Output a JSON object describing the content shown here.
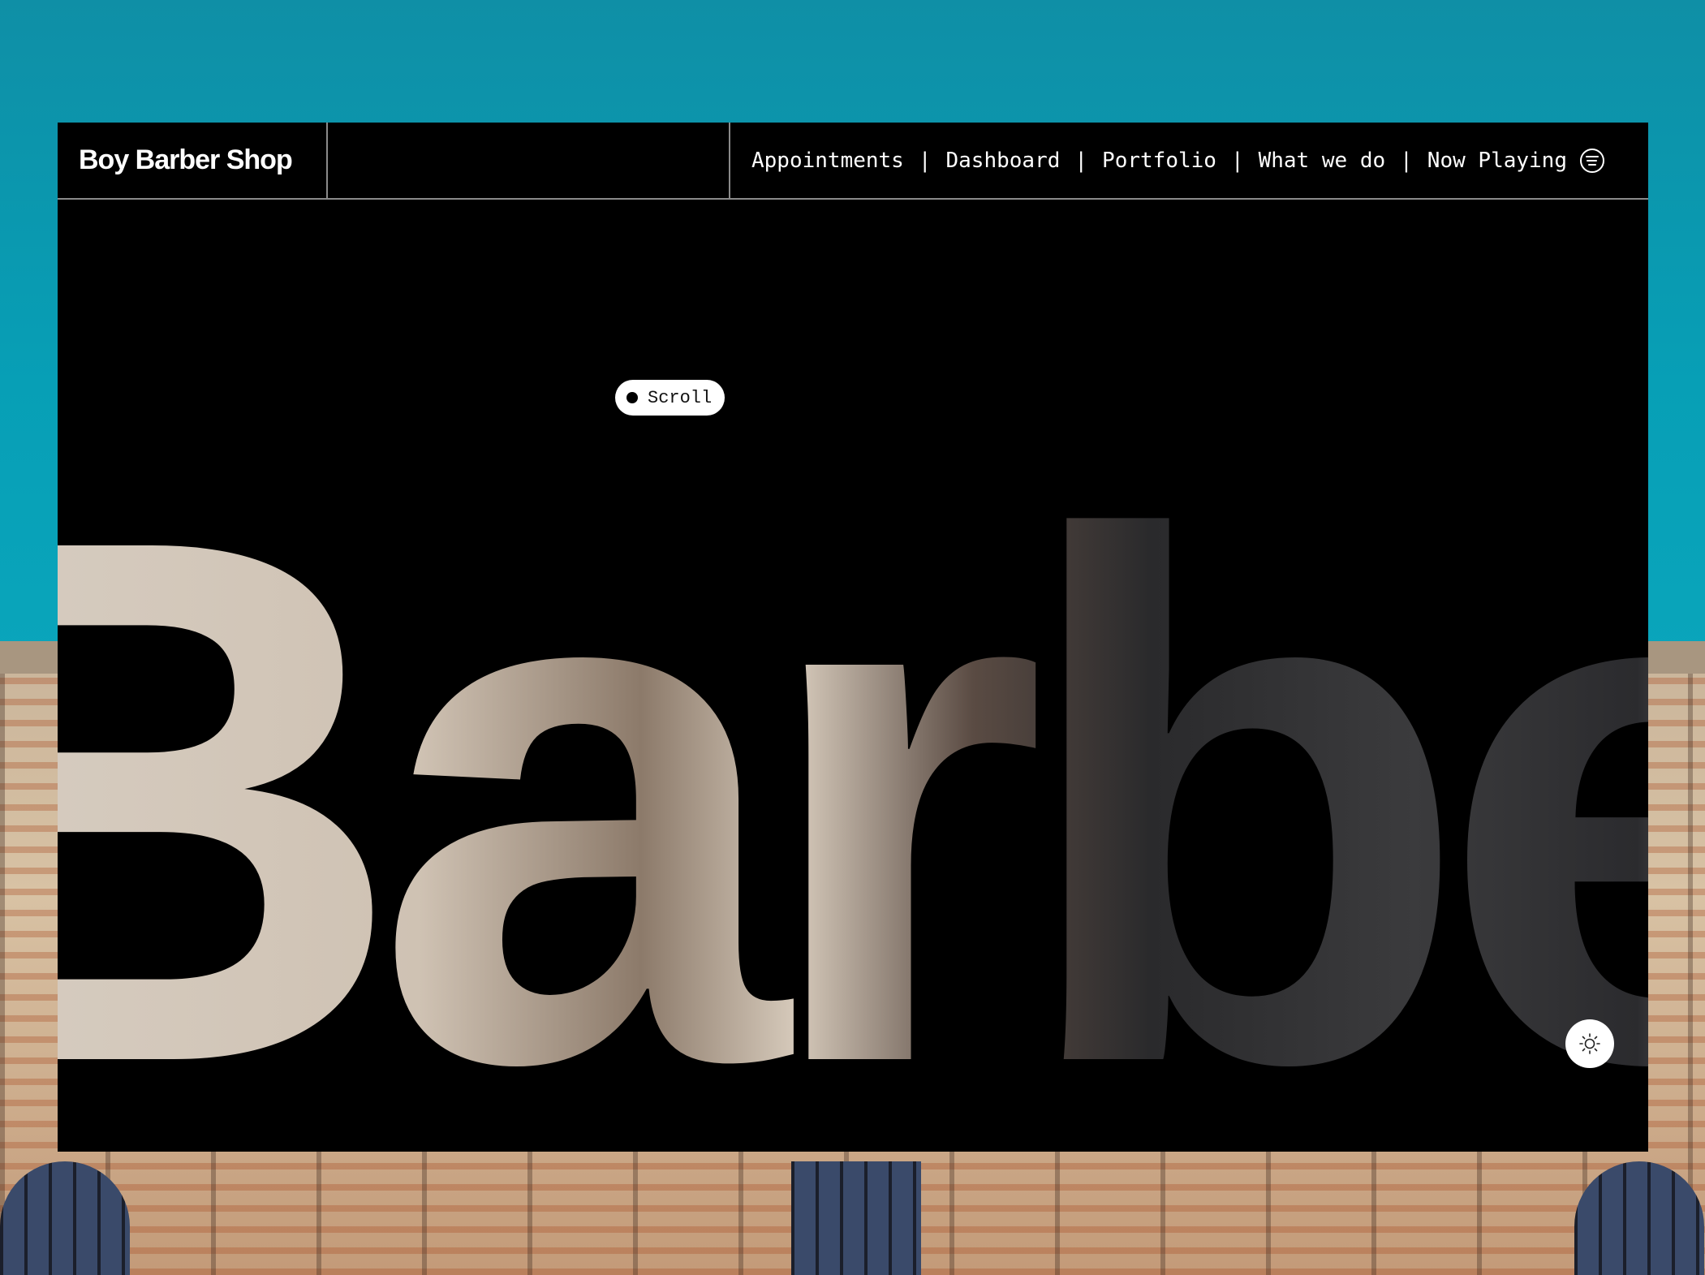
{
  "header": {
    "brand": "Boy Barber Shop",
    "nav": [
      {
        "label": "Appointments"
      },
      {
        "label": "Dashboard"
      },
      {
        "label": "Portfolio"
      },
      {
        "label": "What we do"
      },
      {
        "label": "Now Playing"
      }
    ],
    "separator": "|",
    "now_playing_icon": "spotify-icon"
  },
  "hero": {
    "scroll_label": "Scroll",
    "headline": "Barber",
    "theme_toggle_icon": "sun-icon"
  },
  "colors": {
    "background": "#0aa6bc",
    "window": "#000000",
    "text": "#ffffff"
  }
}
